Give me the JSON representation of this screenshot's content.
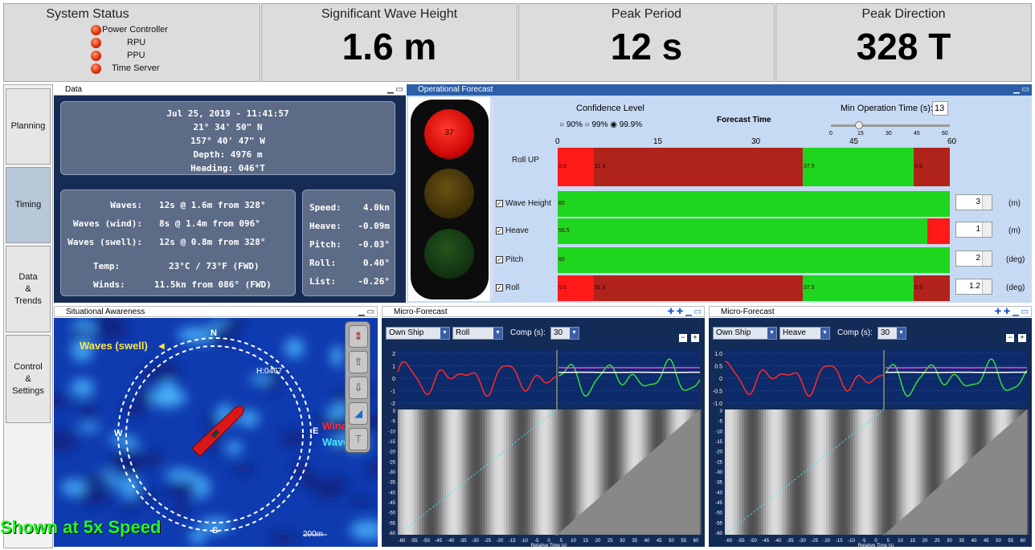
{
  "header": {
    "system_status": {
      "title": "System Status",
      "items": [
        "Power Controller",
        "RPU",
        "PPU",
        "Time Server"
      ]
    },
    "wave_height": {
      "title": "Significant Wave Height",
      "value": "1.6 m"
    },
    "peak_period": {
      "title": "Peak Period",
      "value": "12 s"
    },
    "peak_direction": {
      "title": "Peak Direction",
      "value": "328 T"
    }
  },
  "sidebar": {
    "tabs": [
      "Planning",
      "Timing",
      "Data\n&\nTrends",
      "Control\n&\nSettings"
    ]
  },
  "data_panel": {
    "title": "Data",
    "top": [
      "Jul 25, 2019 - 11:41:57",
      "21° 34' 50\" N",
      "157° 40' 47\" W",
      "Depth: 4976 m",
      "Heading: 046°T"
    ],
    "waves": [
      {
        "label": "Waves:",
        "value": "12s @ 1.6m from 328°"
      },
      {
        "label": "Waves (wind):",
        "value": "8s @ 1.4m from 096°"
      },
      {
        "label": "Waves (swell):",
        "value": "12s @ 0.8m from 328°"
      },
      {
        "label": "Temp:",
        "value": "23°C / 73°F (FWD)"
      },
      {
        "label": "Winds:",
        "value": "11.5kn from 086° (FWD)"
      }
    ],
    "motion": [
      {
        "label": "Speed:",
        "value": "4.0kn"
      },
      {
        "label": "Heave:",
        "value": "-0.09m"
      },
      {
        "label": "Pitch:",
        "value": "-0.03°"
      },
      {
        "label": "Roll:",
        "value": "0.40°"
      },
      {
        "label": "List:",
        "value": "-0.26°"
      }
    ]
  },
  "op_forecast": {
    "title": "Operational Forecast",
    "light_value": "37",
    "confidence_label": "Confidence Level",
    "confidence_options": [
      "90%",
      "99%",
      "99.9%"
    ],
    "selected_confidence": "99.9%",
    "forecast_time_label": "Forecast Time",
    "min_op_label": "Min Operation Time (s):",
    "min_op_value": "13",
    "slider_ticks": [
      "0",
      "15",
      "30",
      "45",
      "60"
    ],
    "axis_ticks": [
      "0",
      "15",
      "30",
      "45",
      "60"
    ],
    "rows": [
      {
        "label": "Roll UP",
        "checkbox": false,
        "spin": "",
        "unit": "",
        "segments": [
          {
            "from": 0,
            "to": 5.5,
            "color": "red"
          },
          {
            "from": 5.5,
            "to": 37.5,
            "color": "darkred"
          },
          {
            "from": 37.5,
            "to": 54.5,
            "color": "green"
          },
          {
            "from": 54.5,
            "to": 60,
            "color": "darkred"
          }
        ],
        "marks": [
          "5.5",
          "31.5",
          "37.5",
          "5.5"
        ]
      },
      {
        "label": "Wave Height",
        "checkbox": true,
        "spin": "3",
        "unit": "(m)",
        "segments": [
          {
            "from": 0,
            "to": 60,
            "color": "green"
          }
        ],
        "marks": [
          "60"
        ]
      },
      {
        "label": "Heave",
        "checkbox": true,
        "spin": "1",
        "unit": "(m)",
        "segments": [
          {
            "from": 0,
            "to": 56.5,
            "color": "green"
          },
          {
            "from": 56.5,
            "to": 60,
            "color": "red"
          }
        ],
        "marks": [
          "56.5"
        ]
      },
      {
        "label": "Pitch",
        "checkbox": true,
        "spin": "2",
        "unit": "(deg)",
        "segments": [
          {
            "from": 0,
            "to": 60,
            "color": "green"
          }
        ],
        "marks": [
          "60"
        ]
      },
      {
        "label": "Roll",
        "checkbox": true,
        "spin": "1.2",
        "unit": "(deg)",
        "segments": [
          {
            "from": 0,
            "to": 5.5,
            "color": "red"
          },
          {
            "from": 5.5,
            "to": 37.5,
            "color": "darkred"
          },
          {
            "from": 37.5,
            "to": 54.5,
            "color": "green"
          },
          {
            "from": 54.5,
            "to": 60,
            "color": "darkred"
          }
        ],
        "marks": [
          "5.5",
          "31.5",
          "37.5",
          "5.5"
        ]
      }
    ]
  },
  "situational": {
    "title": "Situational Awareness",
    "waves_swell": "Waves (swell)",
    "heading": "H:0467",
    "north": "N",
    "south": "S",
    "west": "W",
    "east": "E",
    "wind": "Wind",
    "waves_wind": "Waves (w",
    "scale": "200m",
    "overlay": "Shown at 5x Speed"
  },
  "micro1": {
    "title": "Micro-Forecast",
    "ship": "Own Ship",
    "param": "Roll",
    "comp_label": "Comp (s):",
    "comp_value": "30",
    "y_ticks": [
      "2",
      "1",
      "0",
      "-1",
      "-2"
    ],
    "xlabel": "Relative Time (s)"
  },
  "micro2": {
    "title": "Micro-Forecast",
    "ship": "Own Ship",
    "param": "Heave",
    "comp_label": "Comp (s):",
    "comp_value": "30",
    "y_ticks": [
      "1.0",
      "0.5",
      "0",
      "-0.5",
      "-1.0"
    ],
    "xlabel": "Relative Time (s)"
  },
  "wf_y_ticks": [
    "0",
    "-5",
    "-10",
    "-15",
    "-20",
    "-25",
    "-30",
    "-35",
    "-40",
    "-45",
    "-50",
    "-55",
    "-60"
  ],
  "wf_x_ticks": [
    "-60",
    "-55",
    "-50",
    "-45",
    "-40",
    "-35",
    "-30",
    "-25",
    "-20",
    "-15",
    "-10",
    "-5",
    "0",
    "5",
    "10",
    "15",
    "20",
    "25",
    "30",
    "35",
    "40",
    "45",
    "50",
    "55",
    "60"
  ],
  "colors": {
    "red": "#ff1a1a",
    "darkred": "#b0231a",
    "green": "#1fd61f",
    "panel_blue": "#16315f",
    "map_blue": "#1a4fd0"
  }
}
